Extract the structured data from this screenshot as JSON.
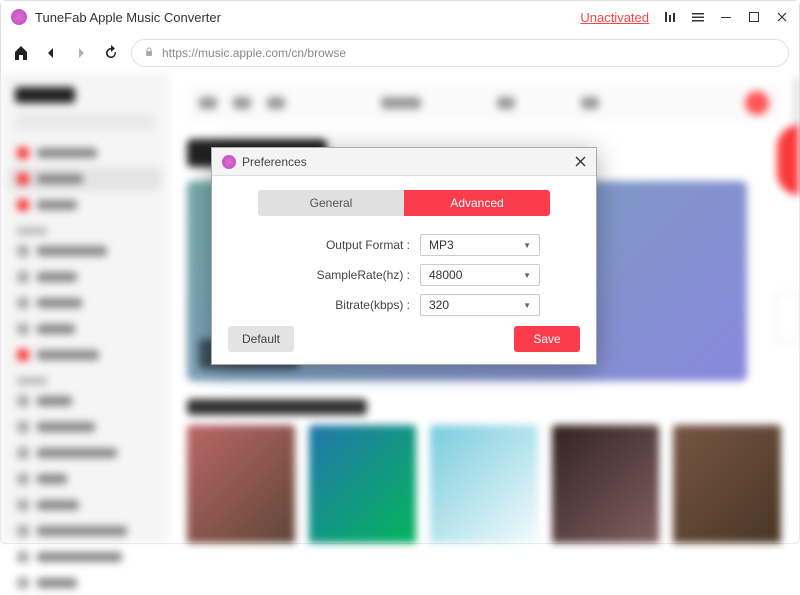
{
  "titlebar": {
    "app_name": "TuneFab Apple Music Converter",
    "unactivated": "Unactivated"
  },
  "urlbar": {
    "url": "https://music.apple.com/cn/browse"
  },
  "dialog": {
    "title": "Preferences",
    "tabs": {
      "general": "General",
      "advanced": "Advanced"
    },
    "fields": {
      "output_format": {
        "label": "Output Format :",
        "value": "MP3"
      },
      "sample_rate": {
        "label": "SampleRate(hz) :",
        "value": "48000"
      },
      "bitrate": {
        "label": "Bitrate(kbps) :",
        "value": "320"
      }
    },
    "buttons": {
      "default": "Default",
      "save": "Save"
    }
  }
}
